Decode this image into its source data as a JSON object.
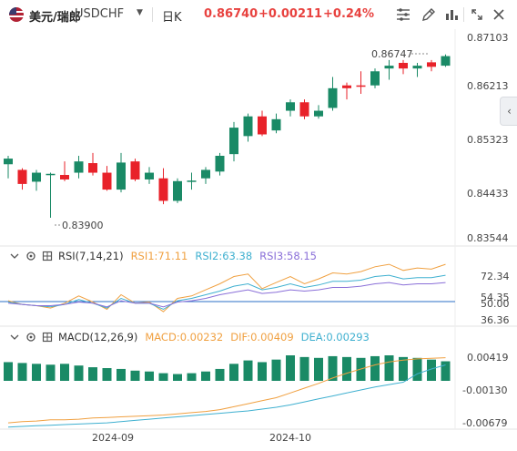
{
  "toolbar": {
    "symbol_name": "美元/瑞郎",
    "symbol_code": "USDCHF",
    "period": "日K",
    "price": "0.86740",
    "change": "+0.00211",
    "change_pct": "+0.24%",
    "icons": [
      "settings-icon",
      "draw-icon",
      "indicator-icon",
      "fullscreen-icon",
      "close-icon"
    ]
  },
  "colors": {
    "up": "#1a8a66",
    "down": "#e8222a",
    "price_text": "#e8423f",
    "rsi1": "#f0a040",
    "rsi2": "#3fb0d0",
    "rsi3": "#8a6fd8",
    "dif": "#f0a040",
    "dea": "#3fb0d0"
  },
  "price_axis": [
    "0.87103",
    "0.86213",
    "0.85323",
    "0.84433",
    "0.83544"
  ],
  "high_label": "0.86747",
  "low_label": "0.83900",
  "rsi": {
    "name": "RSI(7,14,21)",
    "v1": "RSI1:71.11",
    "v2": "RSI2:63.38",
    "v3": "RSI3:58.15",
    "axis": [
      "72.34",
      "54.35",
      "50.00",
      "36.36"
    ]
  },
  "macd": {
    "name": "MACD(12,26,9)",
    "v1": "MACD:0.00232",
    "v2": "DIF:0.00409",
    "v3": "DEA:0.00293",
    "axis": [
      "0.00419",
      "-0.00130",
      "-0.00679"
    ]
  },
  "x_labels": [
    "2024-09",
    "2024-10"
  ],
  "chart_data": {
    "type": "candlestick",
    "candles": [
      {
        "o": 0.8485,
        "c": 0.8495,
        "h": 0.85,
        "l": 0.846
      },
      {
        "o": 0.8475,
        "c": 0.845,
        "h": 0.8478,
        "l": 0.844
      },
      {
        "o": 0.8454,
        "c": 0.847,
        "h": 0.8475,
        "l": 0.8438
      },
      {
        "o": 0.8466,
        "c": 0.8468,
        "h": 0.847,
        "l": 0.839
      },
      {
        "o": 0.8466,
        "c": 0.8458,
        "h": 0.849,
        "l": 0.8455
      },
      {
        "o": 0.847,
        "c": 0.849,
        "h": 0.85,
        "l": 0.846
      },
      {
        "o": 0.8487,
        "c": 0.847,
        "h": 0.8505,
        "l": 0.8465
      },
      {
        "o": 0.847,
        "c": 0.844,
        "h": 0.8482,
        "l": 0.8438
      },
      {
        "o": 0.844,
        "c": 0.8488,
        "h": 0.8505,
        "l": 0.8435
      },
      {
        "o": 0.849,
        "c": 0.8458,
        "h": 0.8495,
        "l": 0.8455
      },
      {
        "o": 0.8458,
        "c": 0.847,
        "h": 0.848,
        "l": 0.845
      },
      {
        "o": 0.846,
        "c": 0.842,
        "h": 0.8478,
        "l": 0.8414
      },
      {
        "o": 0.842,
        "c": 0.8455,
        "h": 0.846,
        "l": 0.8416
      },
      {
        "o": 0.8455,
        "c": 0.8456,
        "h": 0.847,
        "l": 0.844
      },
      {
        "o": 0.846,
        "c": 0.8475,
        "h": 0.848,
        "l": 0.845
      },
      {
        "o": 0.8472,
        "c": 0.85,
        "h": 0.8505,
        "l": 0.8465
      },
      {
        "o": 0.8503,
        "c": 0.855,
        "h": 0.856,
        "l": 0.849
      },
      {
        "o": 0.8535,
        "c": 0.857,
        "h": 0.8575,
        "l": 0.8525
      },
      {
        "o": 0.857,
        "c": 0.8538,
        "h": 0.858,
        "l": 0.8535
      },
      {
        "o": 0.8545,
        "c": 0.8565,
        "h": 0.8575,
        "l": 0.854
      },
      {
        "o": 0.858,
        "c": 0.8595,
        "h": 0.86,
        "l": 0.857
      },
      {
        "o": 0.8595,
        "c": 0.857,
        "h": 0.86,
        "l": 0.8565
      },
      {
        "o": 0.857,
        "c": 0.858,
        "h": 0.859,
        "l": 0.8566
      },
      {
        "o": 0.8585,
        "c": 0.862,
        "h": 0.864,
        "l": 0.858
      },
      {
        "o": 0.8625,
        "c": 0.862,
        "h": 0.863,
        "l": 0.86
      },
      {
        "o": 0.8625,
        "c": 0.8623,
        "h": 0.865,
        "l": 0.861
      },
      {
        "o": 0.8625,
        "c": 0.865,
        "h": 0.8655,
        "l": 0.862
      },
      {
        "o": 0.8655,
        "c": 0.866,
        "h": 0.867,
        "l": 0.8635
      },
      {
        "o": 0.8665,
        "c": 0.8655,
        "h": 0.867,
        "l": 0.8645
      },
      {
        "o": 0.8655,
        "c": 0.866,
        "h": 0.8665,
        "l": 0.864
      },
      {
        "o": 0.8666,
        "c": 0.8658,
        "h": 0.867,
        "l": 0.865
      },
      {
        "o": 0.866,
        "c": 0.8677,
        "h": 0.868,
        "l": 0.8658
      }
    ],
    "rsi1": [
      52,
      49,
      48,
      46,
      50,
      56,
      51,
      45,
      57,
      50,
      51,
      43,
      54,
      56,
      61,
      66,
      72,
      74,
      62,
      67,
      72,
      66,
      70,
      75,
      74,
      76,
      80,
      82,
      77,
      79,
      78,
      82
    ],
    "rsi2": [
      51,
      49,
      48,
      47,
      49,
      53,
      50,
      46,
      54,
      50,
      50,
      45,
      52,
      54,
      57,
      60,
      64,
      66,
      61,
      63,
      66,
      63,
      65,
      68,
      68,
      69,
      72,
      73,
      70,
      71,
      71,
      73
    ],
    "rsi3": [
      50,
      49,
      48,
      48,
      49,
      51,
      50,
      47,
      52,
      50,
      50,
      47,
      51,
      52,
      54,
      57,
      59,
      61,
      58,
      59,
      61,
      60,
      61,
      63,
      63,
      64,
      66,
      67,
      65,
      66,
      66,
      67
    ],
    "macd_hist": [
      0.0022,
      0.0021,
      0.002,
      0.0019,
      0.002,
      0.0018,
      0.0016,
      0.0015,
      0.0014,
      0.0012,
      0.0011,
      0.0009,
      0.0008,
      0.0009,
      0.0011,
      0.0014,
      0.002,
      0.0024,
      0.0022,
      0.0025,
      0.003,
      0.0028,
      0.0027,
      0.0029,
      0.0028,
      0.0027,
      0.0029,
      0.003,
      0.0028,
      0.0027,
      0.0025,
      0.0023
    ],
    "dif": [
      -0.0068,
      -0.0066,
      -0.0065,
      -0.0063,
      -0.0063,
      -0.0062,
      -0.006,
      -0.0059,
      -0.0058,
      -0.0057,
      -0.0056,
      -0.0055,
      -0.0053,
      -0.0051,
      -0.0049,
      -0.0046,
      -0.0041,
      -0.0036,
      -0.0031,
      -0.0026,
      -0.0018,
      -0.001,
      -0.0002,
      0.0007,
      0.0015,
      0.0022,
      0.0029,
      0.0034,
      0.0037,
      0.0039,
      0.004,
      0.0041
    ],
    "dea": [
      -0.0075,
      -0.0074,
      -0.0073,
      -0.0072,
      -0.0071,
      -0.007,
      -0.0069,
      -0.0068,
      -0.0066,
      -0.0064,
      -0.0062,
      -0.006,
      -0.0058,
      -0.0056,
      -0.0054,
      -0.0052,
      -0.005,
      -0.0048,
      -0.0045,
      -0.0042,
      -0.0038,
      -0.0033,
      -0.0028,
      -0.0023,
      -0.0018,
      -0.0013,
      -0.0008,
      -0.0004,
      0.0,
      0.0014,
      0.0022,
      0.0029
    ],
    "x_ticks": [
      {
        "index": 8,
        "label": "2024-09"
      },
      {
        "index": 20,
        "label": "2024-10"
      }
    ]
  }
}
